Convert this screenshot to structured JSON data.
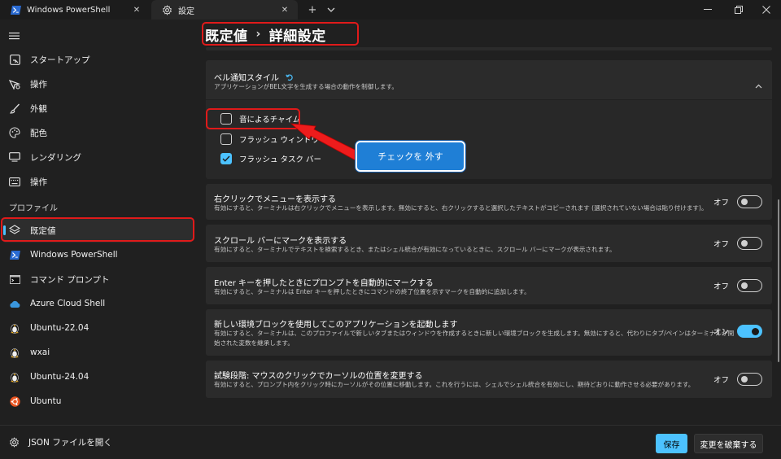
{
  "tabs": [
    {
      "label": "Windows PowerShell",
      "icon": "powershell-icon"
    },
    {
      "label": "設定",
      "icon": "gear-icon"
    }
  ],
  "breadcrumb": {
    "parent": "既定値",
    "separator": "›",
    "current": "詳細設定"
  },
  "sidebar": {
    "items": [
      {
        "label": "スタートアップ",
        "icon": "startup-icon"
      },
      {
        "label": "操作",
        "icon": "interaction-icon"
      },
      {
        "label": "外観",
        "icon": "brush-icon"
      },
      {
        "label": "配色",
        "icon": "palette-icon"
      },
      {
        "label": "レンダリング",
        "icon": "monitor-icon"
      },
      {
        "label": "操作",
        "icon": "keyboard-icon"
      }
    ],
    "profiles_header": "プロファイル",
    "profiles": [
      {
        "label": "既定値",
        "icon": "layers-icon"
      },
      {
        "label": "Windows PowerShell",
        "icon": "powershell-icon"
      },
      {
        "label": "コマンド プロンプト",
        "icon": "cmd-icon"
      },
      {
        "label": "Azure Cloud Shell",
        "icon": "azure-icon"
      },
      {
        "label": "Ubuntu-22.04",
        "icon": "linux-icon"
      },
      {
        "label": "wxai",
        "icon": "linux-icon"
      },
      {
        "label": "Ubuntu-24.04",
        "icon": "linux-icon"
      },
      {
        "label": "Ubuntu",
        "icon": "ubuntu-icon"
      }
    ],
    "footer_link": "JSON ファイルを開く"
  },
  "bell_card": {
    "title": "ベル通知スタイル",
    "desc": "アプリケーションがBEL文字を生成する場合の動作を制御します。",
    "options": [
      {
        "label": "音によるチャイム",
        "checked": false
      },
      {
        "label": "フラッシュ ウィンドウ",
        "checked": false
      },
      {
        "label": "フラッシュ タスク バー",
        "checked": true
      }
    ]
  },
  "callout": {
    "text": "チェックを 外す"
  },
  "settings": [
    {
      "title": "右クリックでメニューを表示する",
      "desc": [
        "有効にすると、ターミナルは右クリックでメニューを表示します。無効にすると、右クリックすると選択したテキストがコピーされます (選択されていない場合は貼り付けます)。"
      ],
      "state_label": "オフ",
      "on": false
    },
    {
      "title": "スクロール バーにマークを表示する",
      "desc": [
        "有効にすると、ターミナルでテキストを検索するとき、またはシェル統合が有効になっているときに、スクロール バーにマークが表示されます。"
      ],
      "state_label": "オフ",
      "on": false
    },
    {
      "title": "Enter キーを押したときにプロンプトを自動的にマークする",
      "desc": [
        "有効にすると、ターミナルは Enter キーを押したときにコマンドの終了位置を示すマークを自動的に追加します。"
      ],
      "state_label": "オフ",
      "on": false
    },
    {
      "title": "新しい環境ブロックを使用してこのアプリケーションを起動します",
      "desc": [
        "有効にすると、ターミナルは、このプロファイルで新しいタブまたはウィンドウを作成するときに新しい環境ブロックを生成します。無効にすると、代わりにタブ/ペインはターミナルが開",
        "始された変数を継承します。"
      ],
      "state_label": "オン",
      "on": true
    },
    {
      "title": "試験段階: マウスのクリックでカーソルの位置を変更する",
      "desc": [
        "有効にすると、プロンプト内をクリック時にカーソルがその位置に移動します。これを行うには、シェルでシェル統合を有効にし、期待どおりに動作させる必要があります。"
      ],
      "state_label": "オフ",
      "on": false
    }
  ],
  "footer": {
    "save_label": "保存",
    "discard_label": "変更を破棄する"
  },
  "colors": {
    "accent": "#4cc2ff",
    "annotation_red": "#e01a1a",
    "callout_blue": "#1f7fd6"
  }
}
